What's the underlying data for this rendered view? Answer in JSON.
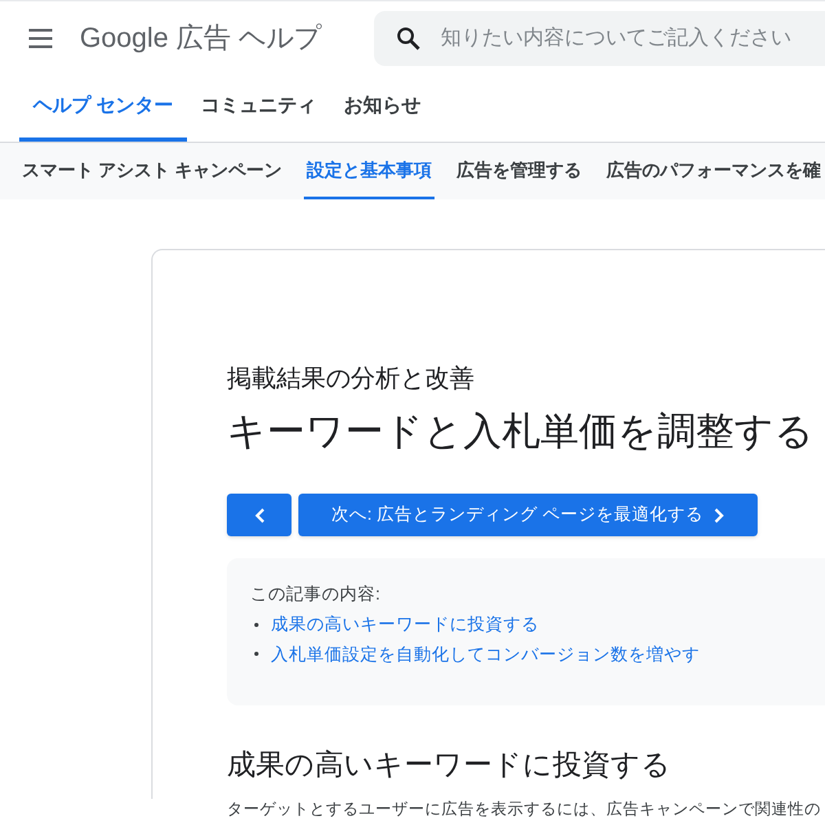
{
  "header": {
    "title": "Google 広告 ヘルプ",
    "search": {
      "placeholder": "知りたい内容についてご記入ください"
    }
  },
  "tabs": [
    {
      "label": "ヘルプ センター",
      "selected": true
    },
    {
      "label": "コミュニティ",
      "selected": false
    },
    {
      "label": "お知らせ",
      "selected": false
    }
  ],
  "subnav": [
    {
      "label": "スマート アシスト キャンペーン",
      "selected": false
    },
    {
      "label": "設定と基本事項",
      "selected": true
    },
    {
      "label": "広告を管理する",
      "selected": false
    },
    {
      "label": "広告のパフォーマンスを確",
      "selected": false
    }
  ],
  "article": {
    "category": "掲載結果の分析と改善",
    "title": "キーワードと入札単価を調整する",
    "next_button": "次へ: 広告とランディング ページを最適化する",
    "toc": {
      "heading": "この記事の内容:",
      "items": [
        "成果の高いキーワードに投資する",
        "入札単価設定を自動化してコンバージョン数を増やす"
      ]
    },
    "section_heading": "成果の高いキーワードに投資する",
    "body": "ターゲットとするユーザーに広告を表示するには、広告キャンペーンで関連性の"
  }
}
